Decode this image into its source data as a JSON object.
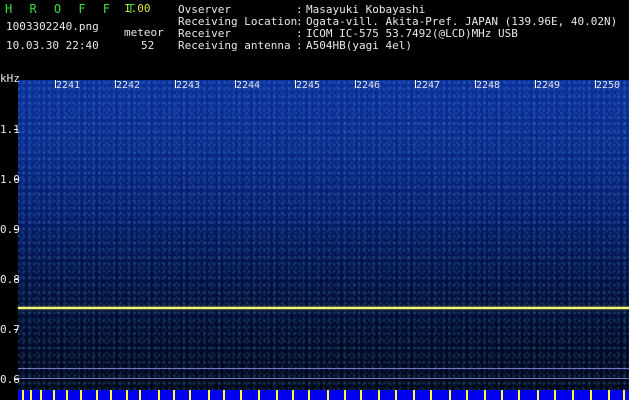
{
  "header": {
    "app_title": "H R O F F T",
    "app_version": "1.00",
    "filename": "1003302240.png",
    "datetime": "10.03.30 22:40",
    "meteor_label": "meteor",
    "meteor_count": "52",
    "info": [
      {
        "key": "Ovserver",
        "value": "Masayuki Kobayashi"
      },
      {
        "key": "Receiving Location",
        "value": "Ogata-vill. Akita-Pref. JAPAN (139.96E, 40.02N)"
      },
      {
        "key": "Receiver",
        "value": "ICOM IC-575 53.7492(@LCD)MHz USB"
      },
      {
        "key": "Receiving antenna",
        "value": "A504HB(yagi 4el)"
      }
    ]
  },
  "axis": {
    "y_unit": "kHz",
    "y_ticks": [
      "1.1",
      "1.0",
      "0.9",
      "0.8",
      "0.7",
      "0.6"
    ],
    "x_ticks": [
      "2241",
      "2242",
      "2243",
      "2244",
      "2245",
      "2246",
      "2247",
      "2248",
      "2249",
      "2250"
    ]
  },
  "colors": {
    "main_line": "#f3f27a",
    "background": "#000000",
    "accent_green": "#33e033"
  }
}
